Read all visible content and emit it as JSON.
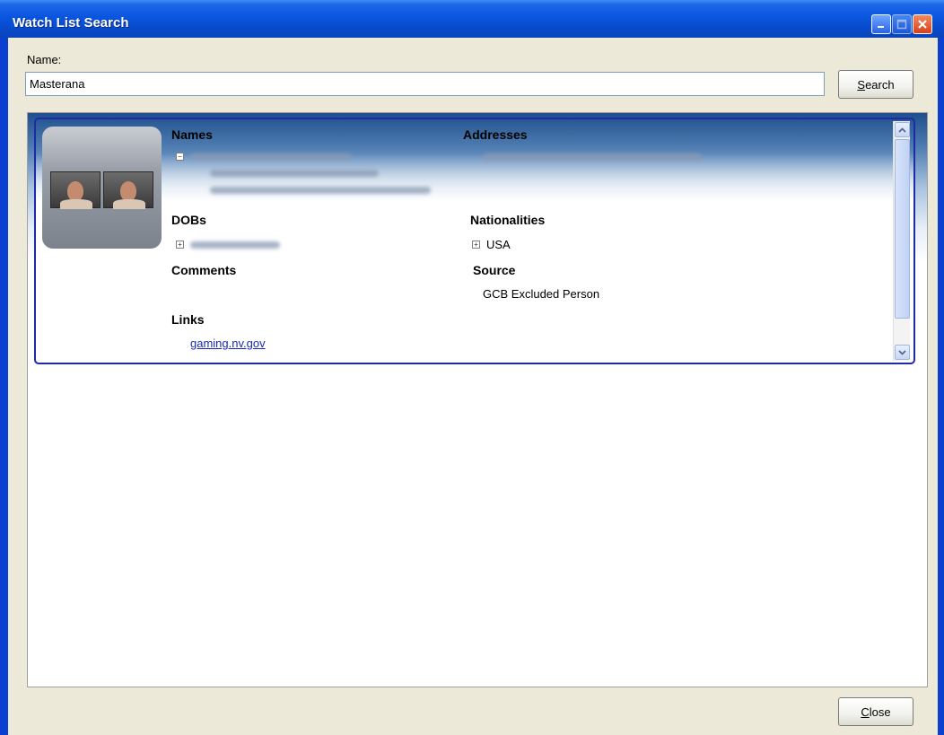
{
  "window": {
    "title": "Watch List Search"
  },
  "search": {
    "name_label": "Name:",
    "value": "Masterana",
    "button_label_underlined": "S",
    "button_label_rest": "earch"
  },
  "result": {
    "names_header": "Names",
    "names_expander": "−",
    "addresses_header": "Addresses",
    "dobs_header": "DOBs",
    "dobs_expander": "+",
    "nationalities_header": "Nationalities",
    "nationality_expander": "+",
    "nationality_value": "USA",
    "comments_header": "Comments",
    "source_header": "Source",
    "source_value": "GCB Excluded Person",
    "links_header": "Links",
    "link_value": "gaming.nv.gov"
  },
  "footer": {
    "close_label_underlined": "C",
    "close_label_rest": "lose"
  },
  "colors": {
    "title_bar": "#0a55df",
    "dialog_bg": "#ece9d8",
    "card_border": "#1e2aa8",
    "link": "#1a2bb5"
  },
  "icons": [
    "minimize-icon",
    "maximize-icon",
    "close-icon",
    "scroll-up-icon",
    "scroll-down-icon"
  ]
}
